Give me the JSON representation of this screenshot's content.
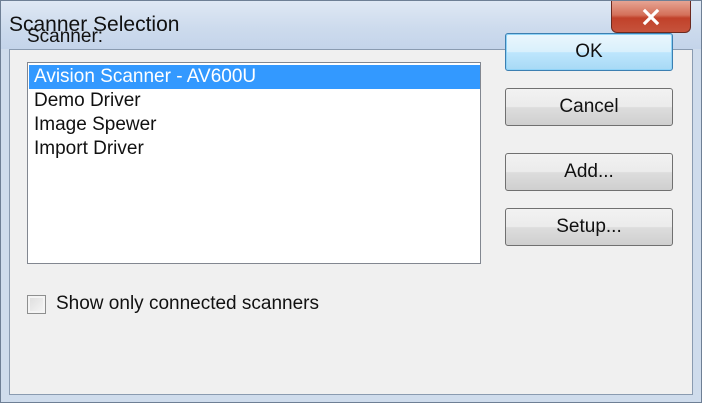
{
  "window": {
    "title": "Scanner Selection",
    "close_icon": "close-icon"
  },
  "scanner_label": "Scanner:",
  "scanners": [
    {
      "label": "Avision Scanner - AV600U",
      "selected": true
    },
    {
      "label": "Demo Driver",
      "selected": false
    },
    {
      "label": "Image Spewer",
      "selected": false
    },
    {
      "label": "Import Driver",
      "selected": false
    }
  ],
  "buttons": {
    "ok": "OK",
    "cancel": "Cancel",
    "add": "Add...",
    "setup": "Setup..."
  },
  "show_connected": {
    "label": "Show only connected scanners",
    "checked": false
  },
  "colors": {
    "selection": "#3399ff",
    "close_button": "#c1412a"
  }
}
